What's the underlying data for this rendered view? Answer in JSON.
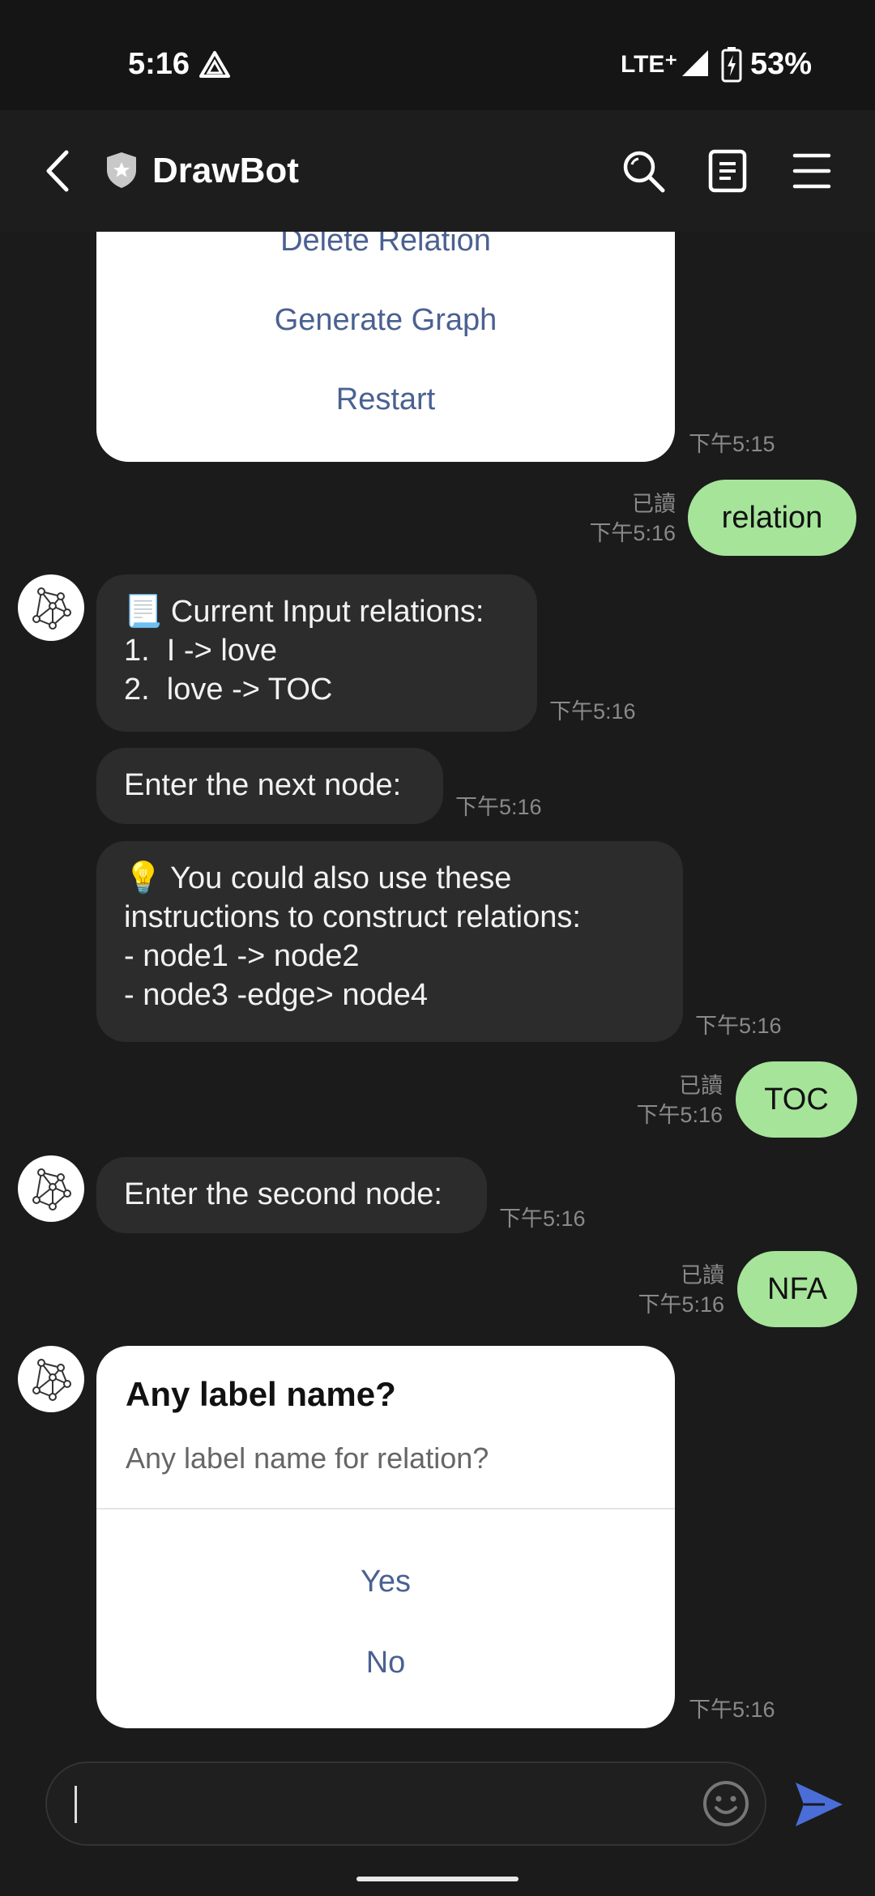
{
  "status_bar": {
    "time": "5:16",
    "network": "LTE⁺",
    "battery": "53%"
  },
  "header": {
    "title": "DrawBot"
  },
  "messages": {
    "menu_card": {
      "btn_delete": "Delete Relation",
      "btn_generate": "Generate Graph",
      "btn_restart": "Restart",
      "time": "下午5:15"
    },
    "out_relation": {
      "text": "relation",
      "read": "已讀",
      "time": "下午5:16"
    },
    "in_relations": {
      "line1": "📃 Current Input relations:",
      "line2": "1.  I -> love",
      "line3": "2.  love -> TOC",
      "time": "下午5:16"
    },
    "in_next_node": {
      "text": "Enter the next node:",
      "time": "下午5:16"
    },
    "in_tip": {
      "line1": "💡 You could also use these",
      "line2": "instructions to construct relations:",
      "line3": "- node1 -> node2",
      "line4": "- node3 -edge> node4",
      "time": "下午5:16"
    },
    "out_toc": {
      "text": "TOC",
      "read": "已讀",
      "time": "下午5:16"
    },
    "in_second_node": {
      "text": "Enter the second node:",
      "time": "下午5:16"
    },
    "out_nfa": {
      "text": "NFA",
      "read": "已讀",
      "time": "下午5:16"
    },
    "label_card": {
      "title": "Any label name?",
      "subtitle": "Any label name for relation?",
      "btn_yes": "Yes",
      "btn_no": "No",
      "time": "下午5:16"
    }
  },
  "composer": {
    "placeholder": ""
  },
  "colors": {
    "outgoing_bubble": "#a6e49a",
    "incoming_bubble": "#2c2c2c",
    "card_button_text": "#4a6191",
    "send_icon": "#4a6dd8"
  }
}
